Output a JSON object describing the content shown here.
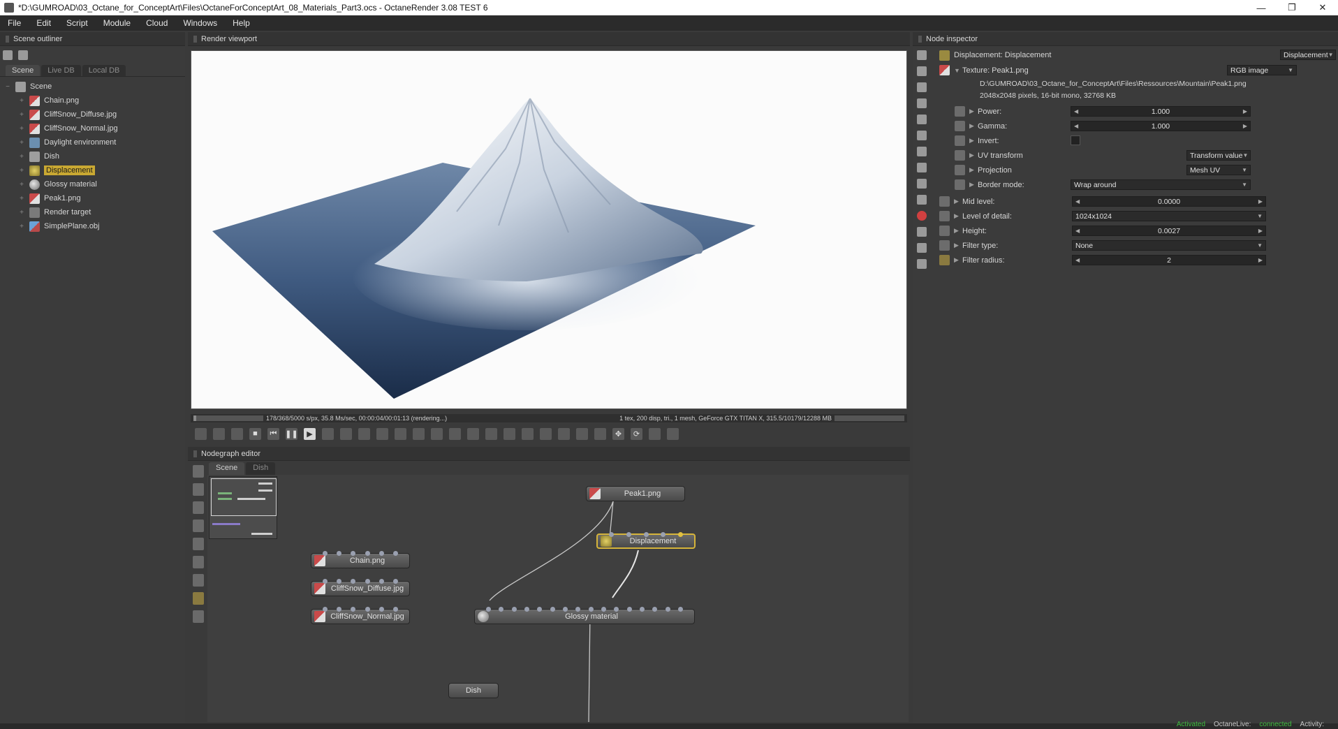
{
  "window": {
    "title": "*D:\\GUMROAD\\03_Octane_for_ConceptArt\\Files\\OctaneForConceptArt_08_Materials_Part3.ocs - OctaneRender 3.08 TEST 6",
    "minimize": "—",
    "maximize": "❐",
    "close": "✕"
  },
  "menu": [
    "File",
    "Edit",
    "Script",
    "Module",
    "Cloud",
    "Windows",
    "Help"
  ],
  "outliner": {
    "title": "Scene outliner",
    "tabs": [
      "Scene",
      "Live DB",
      "Local DB"
    ],
    "root": "Scene",
    "items": [
      {
        "label": "Chain.png",
        "icon": "texture-icon"
      },
      {
        "label": "CliffSnow_Diffuse.jpg",
        "icon": "texture-icon"
      },
      {
        "label": "CliffSnow_Normal.jpg",
        "icon": "texture-icon"
      },
      {
        "label": "Daylight environment",
        "icon": "environment-icon"
      },
      {
        "label": "Dish",
        "icon": "geometry-icon"
      },
      {
        "label": "Displacement",
        "icon": "displacement-icon"
      },
      {
        "label": "Glossy material",
        "icon": "material-icon"
      },
      {
        "label": "Peak1.png",
        "icon": "texture-icon"
      },
      {
        "label": "Render target",
        "icon": "render-target-icon"
      },
      {
        "label": "SimplePlane.obj",
        "icon": "mesh-icon"
      }
    ]
  },
  "viewport": {
    "title": "Render viewport",
    "status_left": "178/368/5000 s/px, 35.8 Ms/sec, 00:00:04/00:01:13 (rendering...)",
    "status_right": "1 tex, 200 disp, tri., 1 mesh, GeForce GTX TITAN X, 315.5/10179/12288 MB",
    "progress": 0.036
  },
  "nodegraph": {
    "title": "Nodegraph editor",
    "tabs": [
      "Scene",
      "Dish"
    ],
    "nodes": {
      "peak": "Peak1.png",
      "displacement": "Displacement",
      "chain": "Chain.png",
      "diffuse": "CliffSnow_Diffuse.jpg",
      "normal": "CliffSnow_Normal.jpg",
      "glossy": "Glossy material",
      "dish": "Dish"
    }
  },
  "inspector": {
    "title": "Node inspector",
    "header_label": "Displacement: Displacement",
    "header_dropdown": "Displacement",
    "texture_label": "Texture: Peak1.png",
    "texture_type": "RGB image",
    "file_path": "D:\\GUMROAD\\03_Octane_for_ConceptArt\\Files\\Ressources\\Mountain\\Peak1.png",
    "file_info": "2048x2048 pixels, 16-bit mono, 32768 KB",
    "power_label": "Power:",
    "power": "1.000",
    "gamma_label": "Gamma:",
    "gamma": "1.000",
    "invert_label": "Invert:",
    "uv_label": "UV transform",
    "uv_value": "Transform value",
    "projection_label": "Projection",
    "projection_value": "Mesh UV",
    "border_label": "Border mode:",
    "border_value": "Wrap around",
    "mid_label": "Mid level:",
    "mid": "0.0000",
    "lod_label": "Level of detail:",
    "lod": "1024x1024",
    "height_label": "Height:",
    "height": "0.0027",
    "filter_type_label": "Filter type:",
    "filter_type": "None",
    "filter_radius_label": "Filter radius:",
    "filter_radius": "2"
  },
  "statusbar": {
    "activated": "Activated",
    "live_label": "OctaneLive:",
    "live_value": "connected",
    "activity": "Activity:"
  }
}
